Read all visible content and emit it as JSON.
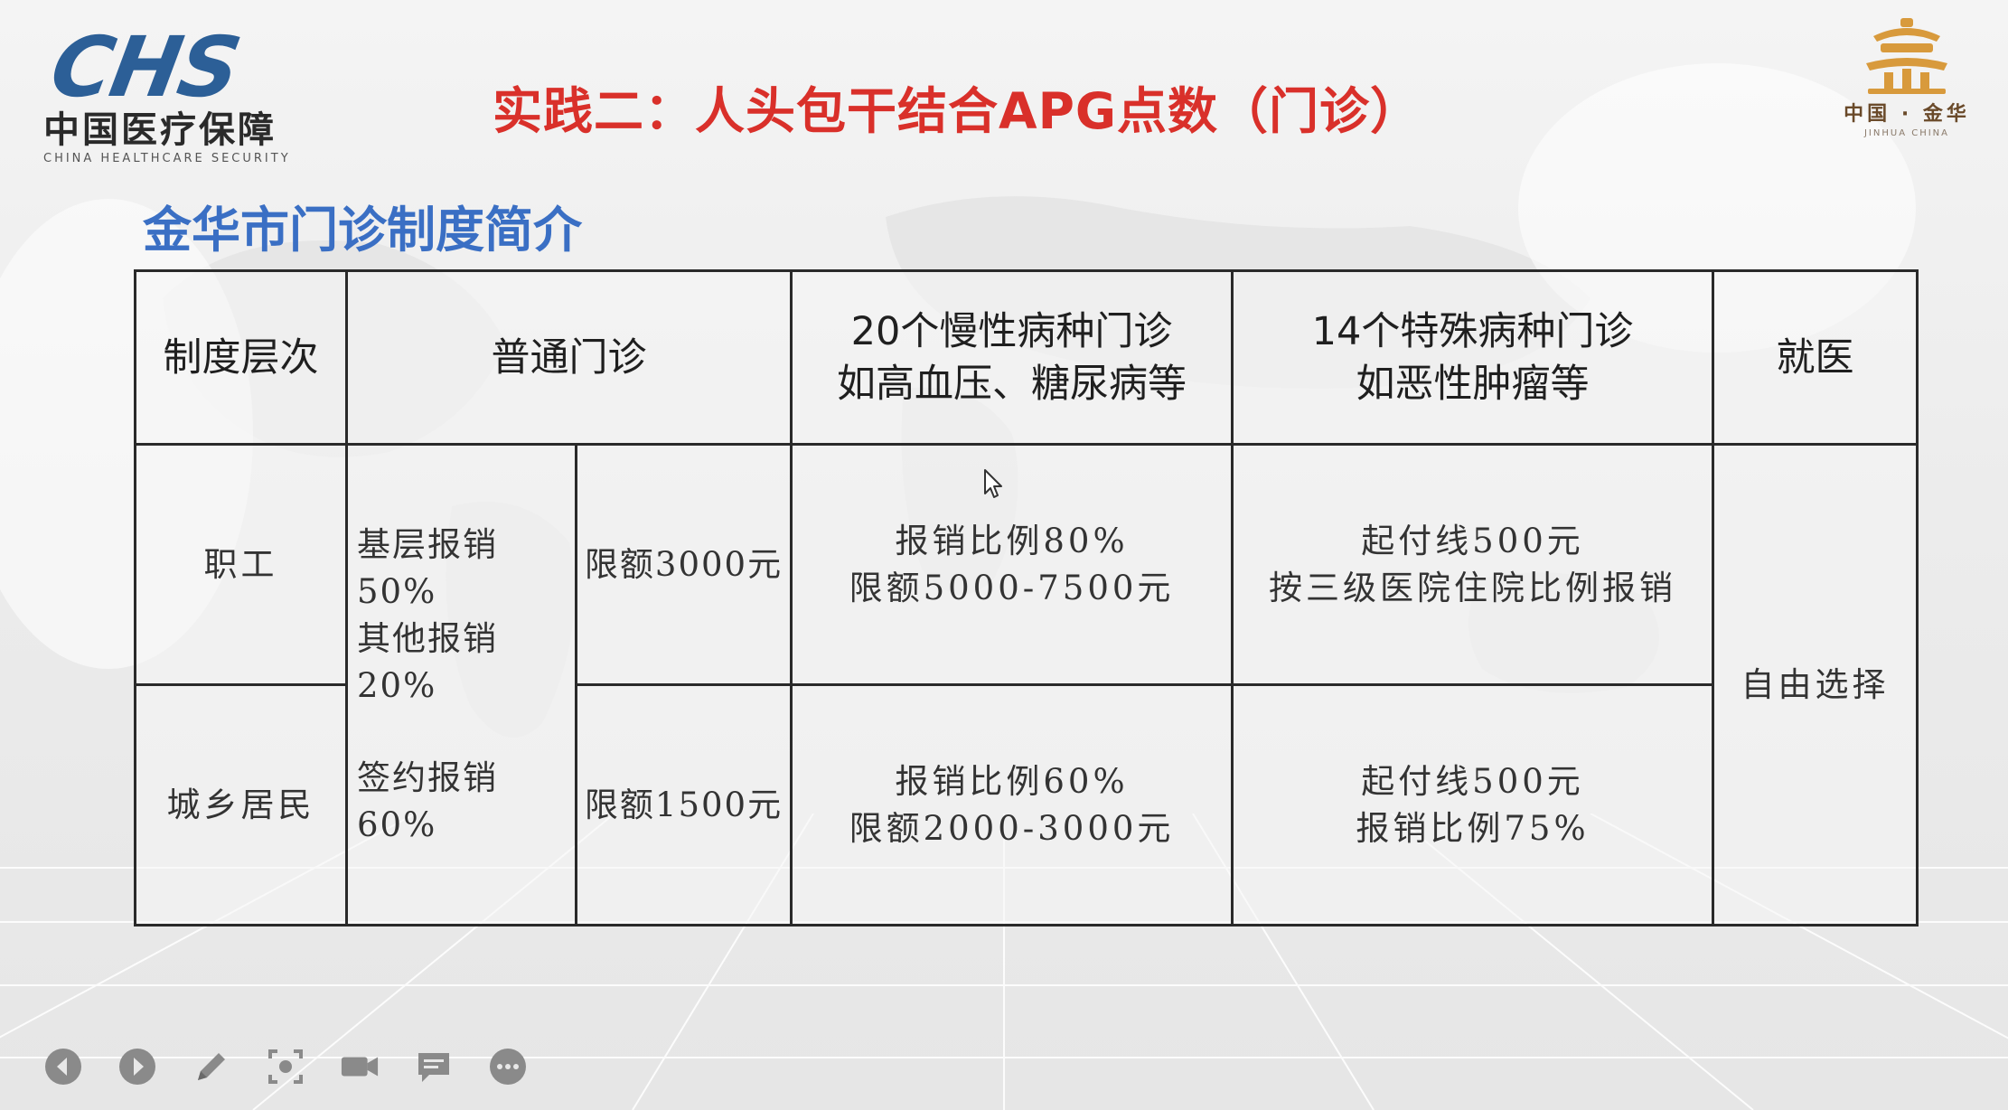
{
  "header": {
    "logo_chs": "CHS",
    "logo_cn": "中国医疗保障",
    "logo_en": "CHINA HEALTHCARE SECURITY",
    "title": "实践二：人头包干结合APG点数（门诊）",
    "right_logo_cn": "中国 · 金华",
    "right_logo_en": "JINHUA CHINA"
  },
  "subtitle": "金华市门诊制度简介",
  "table": {
    "headers": {
      "level": "制度层次",
      "general": "普通门诊",
      "chronic_line1": "20个慢性病种门诊",
      "chronic_line2": "如高血压、糖尿病等",
      "special_line1": "14个特殊病种门诊",
      "special_line2": "如恶性肿瘤等",
      "visit": "就医"
    },
    "rows": {
      "employee": {
        "label": "职工",
        "limit": "限额3000元",
        "chronic_line1": "报销比例80%",
        "chronic_line2": "限额5000-7500元",
        "special_line1": "起付线500元",
        "special_line2": "按三级医院住院比例报销"
      },
      "resident": {
        "label": "城乡居民",
        "limit": "限额1500元",
        "chronic_line1": "报销比例60%",
        "chronic_line2": "限额2000-3000元",
        "special_line1": "起付线500元",
        "special_line2": "报销比例75%"
      }
    },
    "shared_general": {
      "line1": "基层报销50%",
      "line2": "其他报销20%",
      "line3": "签约报销60%"
    },
    "visit_value": "自由选择"
  },
  "toolbar": {
    "icons": [
      "prev-icon",
      "next-icon",
      "pen-icon",
      "screenshot-icon",
      "camera-icon",
      "comment-icon",
      "more-icon"
    ]
  },
  "colors": {
    "title_red": "#d9302a",
    "subtitle_blue": "#3a6fc4",
    "logo_blue": "#2c5f97",
    "logo_gold": "#d89a3c"
  }
}
